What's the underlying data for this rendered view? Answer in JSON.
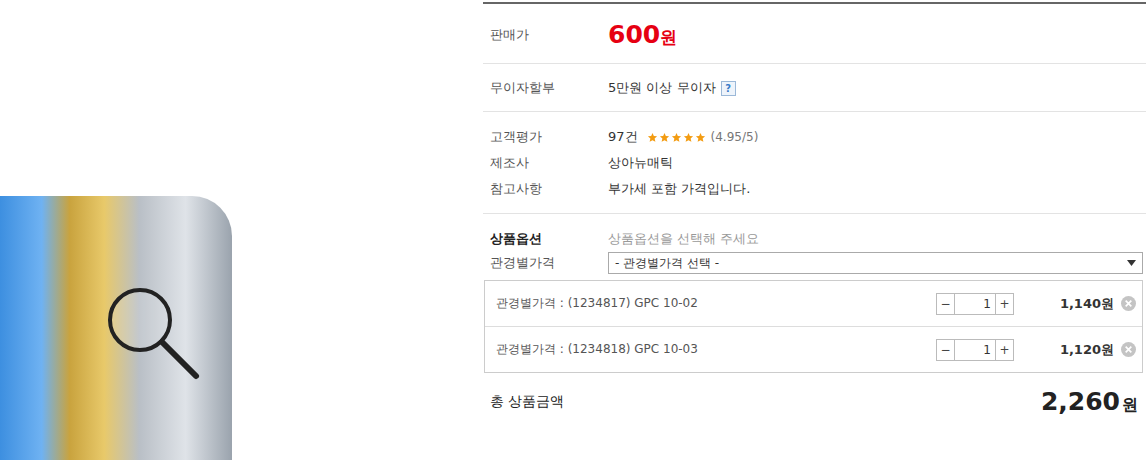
{
  "price": {
    "label": "판매가",
    "amount": "600",
    "unit": "원"
  },
  "installment": {
    "label": "무이자할부",
    "value": "5만원 이상 무이자",
    "help": "?"
  },
  "rating": {
    "label": "고객평가",
    "count": "97건",
    "stars": 5,
    "score": "(4.95/5)"
  },
  "maker": {
    "label": "제조사",
    "value": "상아뉴매틱"
  },
  "note": {
    "label": "참고사항",
    "value": "부가세 포함 가격입니다."
  },
  "options": {
    "label": "상품옵션",
    "hint": "상품옵션을 선택해 주세요"
  },
  "select": {
    "label": "관경별가격",
    "value": "- 관경별가격 선택 -",
    "expanded": false
  },
  "selected_items": [
    {
      "label": "관경별가격 : (1234817) GPC 10-02",
      "minus": "−",
      "quantity": "1",
      "plus": "+",
      "price": "1,140원"
    },
    {
      "label": "관경별가격 : (1234818) GPC 10-03",
      "minus": "−",
      "quantity": "1",
      "plus": "+",
      "price": "1,120원"
    }
  ],
  "total": {
    "label": "총 상품금액",
    "amount": "2,260",
    "unit": "원"
  }
}
